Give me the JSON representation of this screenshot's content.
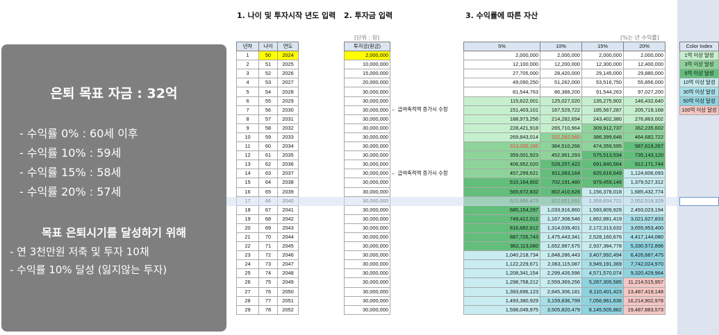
{
  "note": {
    "title": "은퇴 목표 자금 : 32억",
    "lines": [
      "- 수익률   0% : 60세 이후",
      "- 수익률 10% : 59세",
      "- 수익률 15% : 58세",
      "- 수익률 20% : 57세"
    ],
    "subtitle": "목표 은퇴시기를 달성하기 위해",
    "lines2": [
      "- 연 3천만원 저축 및 투자 10채",
      "- 수익률 10% 달성 (잃지않는 투자)"
    ]
  },
  "sections": {
    "s1": "1. 나이 및 투자시작 년도 입력",
    "s2": "2. 투자금 입력",
    "s3": "3. 수익률에 따른 자산"
  },
  "unit_note": "[단위 : 원]",
  "rate_note": "[%는 년 수익률]",
  "left_headers": [
    "년차",
    "나이",
    "연도"
  ],
  "invest_header": "투자금(원금)",
  "return_headers": [
    "5%",
    "10%",
    "15%",
    "20%"
  ],
  "color_index": {
    "header": "Color Index",
    "items": [
      "1억 이상 달성",
      "3억 이상 달성",
      "5억 이상 달성",
      "10억 이상 달성",
      "30억 이상 달성",
      "50억 이상 달성",
      "100억 이상 달성"
    ],
    "colors": [
      "#c6efce",
      "#8ed49a",
      "#63be7b",
      "#c8ecf0",
      "#a9dfe8",
      "#8fd3e0",
      "#f4c7c3"
    ]
  },
  "memo": "← 급여축적액 증가시 수정",
  "colors": {
    "yellow": "#ffff00",
    "header_blue": "#dbe5f1",
    "red_text": "#ff3b3b"
  },
  "rows": [
    [
      "1",
      "50",
      "2024",
      "2,000,000",
      "2,000,000",
      "2,000,000",
      "2,000,000",
      "2,000,000"
    ],
    [
      "2",
      "51",
      "2025",
      "10,000,000",
      "12,100,000",
      "12,200,000",
      "12,300,000",
      "12,400,000"
    ],
    [
      "3",
      "52",
      "2026",
      "15,000,000",
      "27,705,000",
      "28,420,000",
      "29,145,000",
      "29,880,000"
    ],
    [
      "4",
      "53",
      "2027",
      "20,000,000",
      "49,090,250",
      "51,262,000",
      "53,516,750",
      "55,856,000"
    ],
    [
      "5",
      "54",
      "2028",
      "30,000,000",
      "81,544,763",
      "86,388,200",
      "91,544,263",
      "97,027,200"
    ],
    [
      "6",
      "55",
      "2029",
      "30,000,000",
      "115,622,001",
      "125,027,020",
      "135,275,902",
      "146,432,640"
    ],
    [
      "7",
      "56",
      "2030",
      "30,000,000",
      "151,403,101",
      "167,529,722",
      "185,567,287",
      "205,719,168"
    ],
    [
      "8",
      "57",
      "2031",
      "30,000,000",
      "188,973,256",
      "214,282,694",
      "243,402,380",
      "276,863,002"
    ],
    [
      "9",
      "58",
      "2032",
      "30,000,000",
      "228,421,918",
      "265,710,964",
      "309,912,737",
      "362,235,602"
    ],
    [
      "10",
      "59",
      "2033",
      "30,000,000",
      "269,843,014",
      "322,282,060",
      "386,399,648",
      "464,682,722"
    ],
    [
      "11",
      "60",
      "2034",
      "30,000,000",
      "313,335,165",
      "384,510,266",
      "474,359,595",
      "587,619,267"
    ],
    [
      "12",
      "61",
      "2035",
      "30,000,000",
      "359,001,923",
      "452,961,293",
      "575,513,534",
      "735,143,120"
    ],
    [
      "13",
      "62",
      "2036",
      "30,000,000",
      "406,952,020",
      "528,257,422",
      "691,840,564",
      "912,171,744"
    ],
    [
      "14",
      "63",
      "2037",
      "30,000,000",
      "457,299,621",
      "611,083,164",
      "825,616,649",
      "1,124,606,093"
    ],
    [
      "15",
      "64",
      "2038",
      "30,000,000",
      "510,164,602",
      "702,191,480",
      "979,459,146",
      "1,379,527,312"
    ],
    [
      "16",
      "65",
      "2039",
      "30,000,000",
      "565,672,832",
      "802,410,628",
      "1,156,378,018",
      "1,685,432,774"
    ],
    [
      "17",
      "66",
      "2040",
      "30,000,000",
      "623,956,473",
      "912,651,691",
      "1,359,834,721",
      "2,052,519,329"
    ],
    [
      "18",
      "67",
      "2041",
      "30,000,000",
      "685,154,297",
      "1,033,916,860",
      "1,593,809,929",
      "2,493,023,194"
    ],
    [
      "19",
      "68",
      "2042",
      "30,000,000",
      "749,412,012",
      "1,167,308,546",
      "1,862,881,419",
      "3,021,627,833"
    ],
    [
      "20",
      "69",
      "2043",
      "30,000,000",
      "816,882,612",
      "1,314,039,401",
      "2,172,313,632",
      "3,655,953,400"
    ],
    [
      "21",
      "70",
      "2044",
      "30,000,000",
      "887,726,743",
      "1,475,443,341",
      "2,528,160,676",
      "4,417,144,080"
    ],
    [
      "22",
      "71",
      "2045",
      "30,000,000",
      "962,113,080",
      "1,652,987,675",
      "2,937,384,778",
      "5,330,572,896"
    ],
    [
      "23",
      "72",
      "2046",
      "30,000,000",
      "1,040,218,734",
      "1,848,286,443",
      "3,407,992,494",
      "6,426,687,475"
    ],
    [
      "24",
      "73",
      "2047",
      "30,000,000",
      "1,122,229,671",
      "2,063,115,087",
      "3,949,191,369",
      "7,742,024,970"
    ],
    [
      "25",
      "74",
      "2048",
      "30,000,000",
      "1,208,341,154",
      "2,299,426,596",
      "4,571,570,074",
      "9,320,429,964"
    ],
    [
      "26",
      "75",
      "2049",
      "30,000,000",
      "1,298,758,212",
      "2,559,369,256",
      "5,287,305,585",
      "11,214,515,957"
    ],
    [
      "27",
      "76",
      "2050",
      "30,000,000",
      "1,393,696,123",
      "2,845,306,181",
      "6,110,401,423",
      "13,487,419,148"
    ],
    [
      "28",
      "77",
      "2051",
      "30,000,000",
      "1,493,380,929",
      "3,159,836,799",
      "7,056,961,636",
      "16,214,902,978"
    ],
    [
      "29",
      "78",
      "2052",
      "30,000,000",
      "1,598,049,975",
      "3,505,820,479",
      "8,145,505,882",
      "19,487,883,573"
    ]
  ]
}
